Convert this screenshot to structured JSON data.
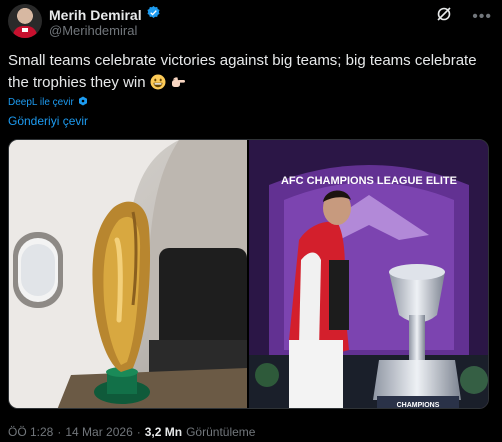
{
  "author": {
    "display_name": "Merih Demiral",
    "handle": "@Merihdemiral",
    "verified_icon": "verified-badge-icon"
  },
  "tweet": {
    "text": "Small teams celebrate victories against big teams; big teams celebrate the trophies they win",
    "emojis": [
      "grinning-face-icon",
      "pointing-hand-icon"
    ]
  },
  "translation": {
    "deepl_label": "DeepL ile çevir",
    "translate_label": "Gönderiyi çevir"
  },
  "media": {
    "right_photo_banner": "AFC CHAMPIONS LEAGUE ELITE",
    "trophy_plate": "CHAMPIONS"
  },
  "meta": {
    "time": "ÖÖ 1:28",
    "date": "14 Mar 2026",
    "views_count": "3,2 Mn",
    "views_label": "Görüntüleme",
    "separator": "·"
  },
  "colors": {
    "background": "#000000",
    "text": "#e7e9ea",
    "secondary": "#71767b",
    "link": "#1d9bf0",
    "verified": "#1d9bf0"
  }
}
